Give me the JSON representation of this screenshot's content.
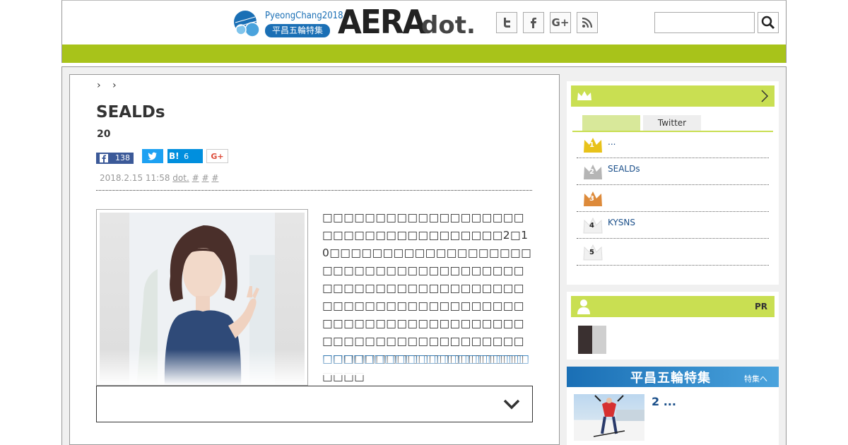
{
  "header": {
    "olympic_logo_line1": "PyeongChang2018",
    "olympic_logo_line2": "平昌五輪特集",
    "brand_main": "AERA",
    "brand_sub": "dot.",
    "social": [
      {
        "name": "twitter",
        "glyph": "t"
      },
      {
        "name": "facebook",
        "glyph": "f"
      },
      {
        "name": "google-plus",
        "glyph": "G+"
      },
      {
        "name": "rss",
        "glyph": "rss"
      }
    ],
    "search_placeholder": "",
    "accent_color": "#a8c31a"
  },
  "article": {
    "breadcrumb": "› ›",
    "title": "SEALDs",
    "subtitle": "20",
    "share": {
      "facebook_count": "138",
      "hatena_label": "B!",
      "hatena_count": "6",
      "gplus_label": "G+"
    },
    "meta": {
      "date": "2018.2.15 11:58",
      "source": "dot.",
      "tags": [
        "#",
        "#",
        "#"
      ]
    },
    "body_text": "□□□□□□□□□□□□□□□□□□□□□□□□□□□□□□□□□□□□2□10□□□□□□□□□□□□□□□□□□□□□□□□□□□□□□□□□□□□□□□□□□□□□□□□□□□□□□□□□□□□□□□□□□□□□□□□□□□□□□□□□□□□□□□□□□□□□□□□□□□□□□□□□□□□□□□□□□□□□□□□□□□□□□□□□□□□□□□□□",
    "body_link": "□□□□□□□□□□□□□□□□□□□□□□□□",
    "read_more": ""
  },
  "sidebar": {
    "ranking": {
      "tabs": [
        "",
        "Twitter"
      ],
      "items": [
        {
          "rank": "1",
          "text": "...",
          "crown": "gold"
        },
        {
          "rank": "2",
          "text": "SEALDs",
          "crown": "silver"
        },
        {
          "rank": "3",
          "text": "",
          "crown": "bronze"
        },
        {
          "rank": "4",
          "text": "KYSNS",
          "crown": "plain"
        },
        {
          "rank": "5",
          "text": "",
          "crown": "plain"
        }
      ]
    },
    "pr": {
      "label": "PR"
    },
    "olympic": {
      "title": "平昌五輪特集",
      "more": "特集へ",
      "headline": "2 ..."
    }
  }
}
